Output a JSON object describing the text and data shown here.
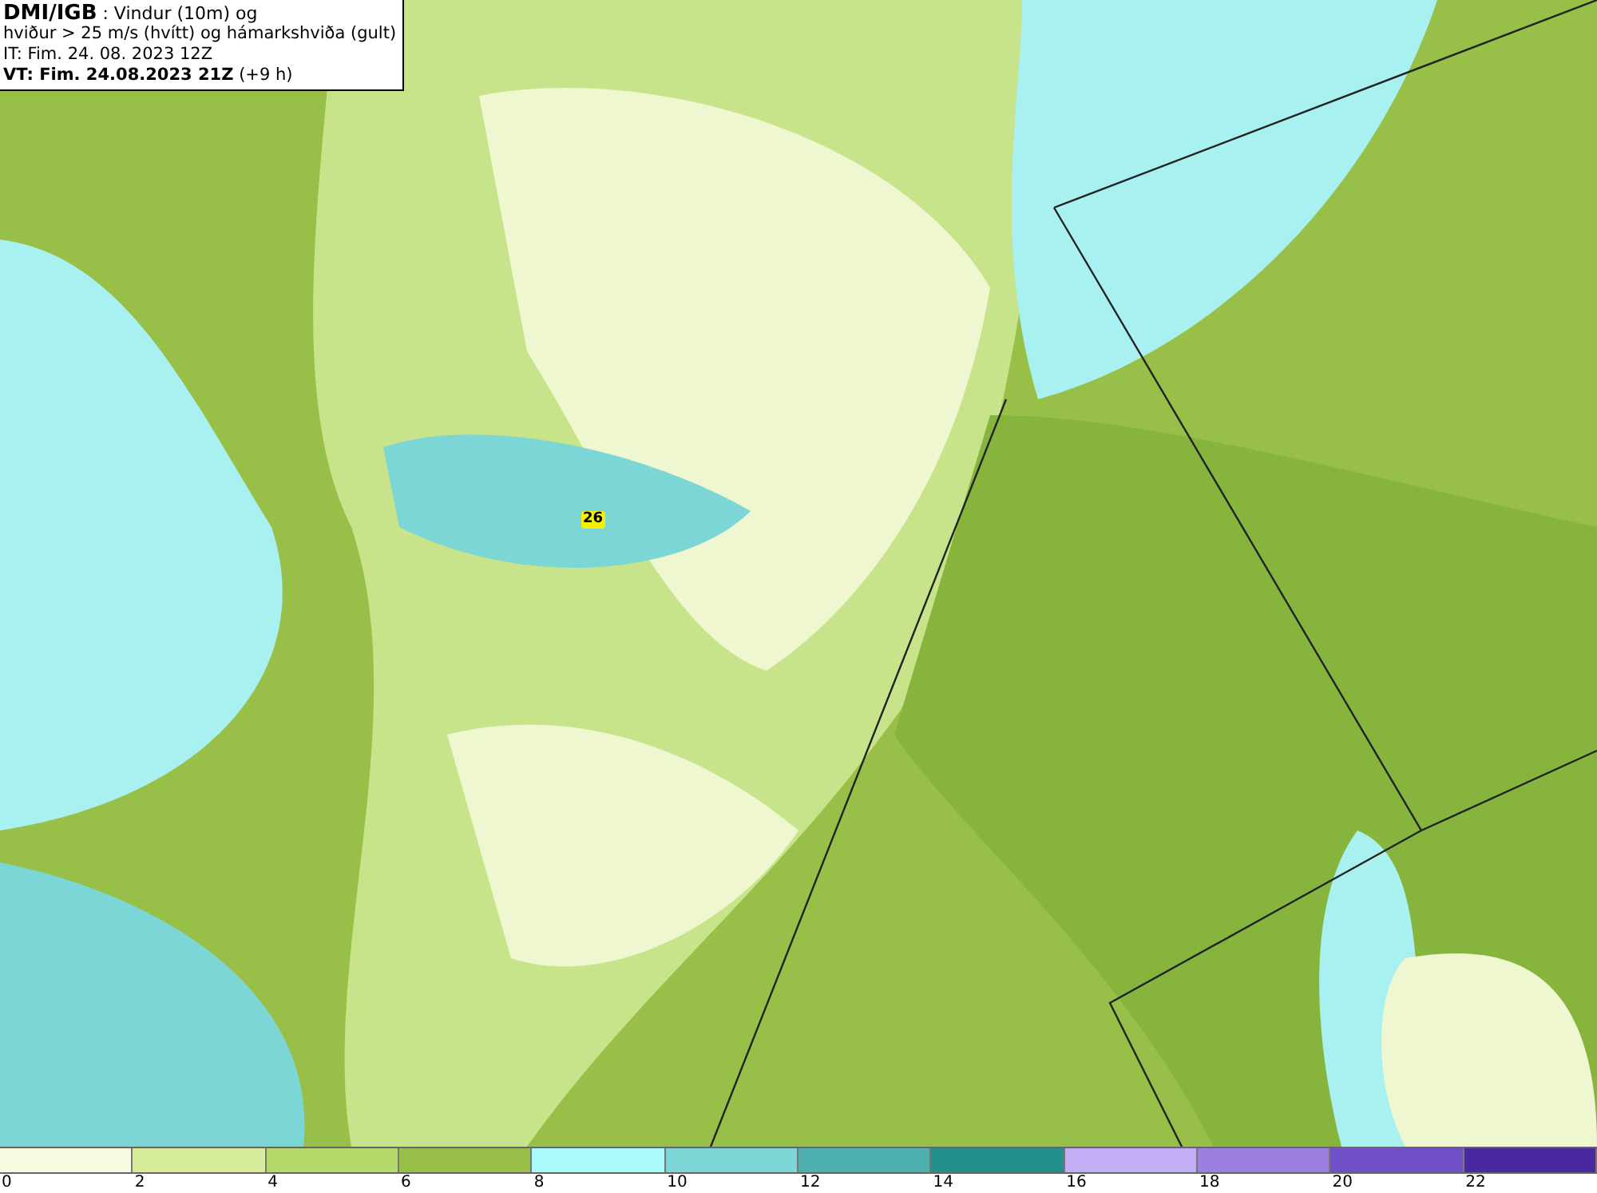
{
  "header": {
    "source": "DMI/IGB",
    "title": ": Vindur (10m) og",
    "subtitle": "hviður > 25 m/s (hvítt) og hámarkshviða (gult)",
    "issue_time": "IT: Fim. 24. 08. 2023 12Z",
    "valid_time": "VT: Fim. 24.08.2023 21Z",
    "valid_offset": "(+9 h)"
  },
  "map": {
    "max_gust_label": "26"
  },
  "legend": [
    {
      "color": "#f5fbe0",
      "label": "0"
    },
    {
      "color": "#d6ec9a",
      "label": "2"
    },
    {
      "color": "#b5d86a",
      "label": "4"
    },
    {
      "color": "#98c048",
      "label": "6"
    },
    {
      "color": "#a9fcfb",
      "label": "8"
    },
    {
      "color": "#7dd6d6",
      "label": "10"
    },
    {
      "color": "#4fb0b0",
      "label": "12"
    },
    {
      "color": "#23908e",
      "label": "14"
    },
    {
      "color": "#c2aef5",
      "label": "16"
    },
    {
      "color": "#9b80e0",
      "label": "18"
    },
    {
      "color": "#7050c8",
      "label": "20"
    },
    {
      "color": "#4a28a0",
      "label": "22"
    }
  ]
}
